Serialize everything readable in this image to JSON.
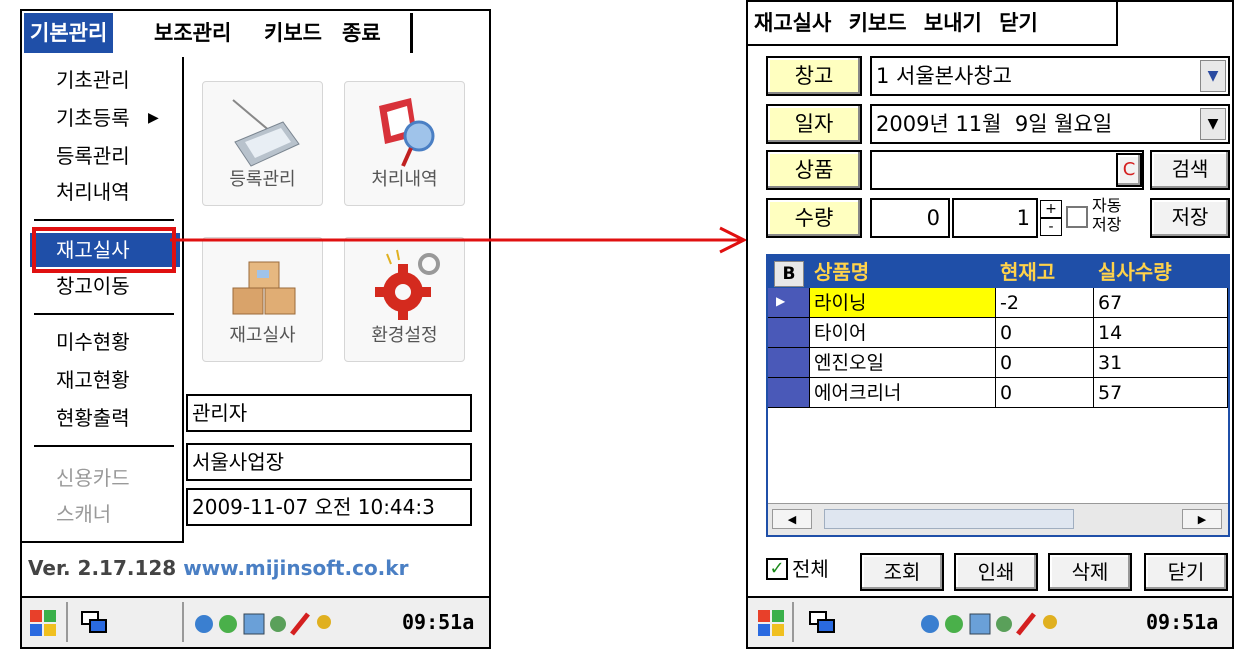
{
  "left_screen": {
    "menubar": [
      "기본관리",
      "보조관리",
      "키보드",
      "종료"
    ],
    "dropdown": {
      "items": [
        "기초관리",
        "기초등록",
        "등록관리",
        "처리내역",
        "재고실사",
        "창고이동",
        "미수현황",
        "재고현황",
        "현황출력",
        "신용카드",
        "스캐너"
      ],
      "selected": "재고실사",
      "disabled": [
        "신용카드",
        "스캐너"
      ],
      "submenu_item": "기초등록"
    },
    "tiles": [
      "등록관리",
      "처리내역",
      "재고실사",
      "환경설정"
    ],
    "info": {
      "user": "관리자",
      "site": "서울사업장",
      "datetime": "2009-11-07 오전 10:44:3"
    },
    "version": "Ver. 2.17.128",
    "website": "www.mijinsoft.co.kr",
    "clock": "09:51a"
  },
  "right_screen": {
    "menubar": [
      "재고실사",
      "키보드",
      "보내기",
      "닫기"
    ],
    "fields": {
      "warehouse_label": "창고",
      "warehouse_value": "1 서울본사창고",
      "date_label": "일자",
      "date_value": "2009년 11월  9일 월요일",
      "product_label": "상품",
      "product_value": "",
      "clear_btn": "C",
      "search_btn": "검색",
      "qty_label": "수량",
      "qty_left": "0",
      "qty_right": "1",
      "plus": "+",
      "minus": "-",
      "autosave_line1": "자동",
      "autosave_line2": "저장",
      "save_btn": "저장"
    },
    "grid": {
      "corner": "B",
      "headers": [
        "상품명",
        "현재고",
        "실사수량"
      ],
      "rows": [
        [
          "라이닝",
          "-2",
          "67"
        ],
        [
          "타이어",
          "0",
          "14"
        ],
        [
          "엔진오일",
          "0",
          "31"
        ],
        [
          "에어크리너",
          "0",
          "57"
        ]
      ]
    },
    "bottom": {
      "all_label": "전체",
      "buttons": [
        "조회",
        "인쇄",
        "삭제",
        "닫기"
      ]
    },
    "clock": "09:51a"
  },
  "colors": {
    "menu_blue": "#1f4fa8",
    "label_yellow": "#ffffc0",
    "highlight_red": "#e01010",
    "header_text": "#ffd24a"
  }
}
